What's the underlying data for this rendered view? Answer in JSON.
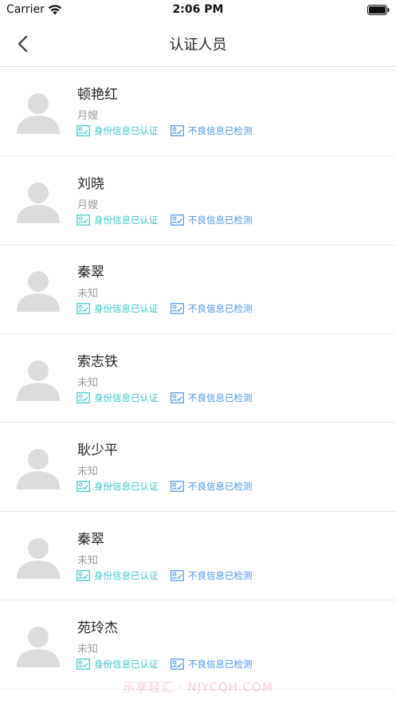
{
  "status_bar": {
    "carrier": "Carrier",
    "time": "2:06 PM"
  },
  "nav": {
    "title": "认证人员",
    "back_icon": "chevron-left-icon"
  },
  "colors": {
    "id_badge": "#37c6c4",
    "bad_badge": "#4a8ff0",
    "avatar_placeholder": "#dcdcdc"
  },
  "people": [
    {
      "name": "顿艳红",
      "role": "月嫂",
      "id_badge": "身份信息已认证",
      "bad_badge": "不良信息已检测"
    },
    {
      "name": "刘晓",
      "role": "月嫂",
      "id_badge": "身份信息已认证",
      "bad_badge": "不良信息已检测"
    },
    {
      "name": "秦翠",
      "role": "未知",
      "id_badge": "身份信息已认证",
      "bad_badge": "不良信息已检测"
    },
    {
      "name": "索志铁",
      "role": "未知",
      "id_badge": "身份信息已认证",
      "bad_badge": "不良信息已检测"
    },
    {
      "name": "耿少平",
      "role": "未知",
      "id_badge": "身份信息已认证",
      "bad_badge": "不良信息已检测"
    },
    {
      "name": "秦翠",
      "role": "未知",
      "id_badge": "身份信息已认证",
      "bad_badge": "不良信息已检测"
    },
    {
      "name": "苑玲杰",
      "role": "未知",
      "id_badge": "身份信息已认证",
      "bad_badge": "不良信息已检测"
    }
  ],
  "watermark": "乐享轻汇 · NJYCQH.COM"
}
